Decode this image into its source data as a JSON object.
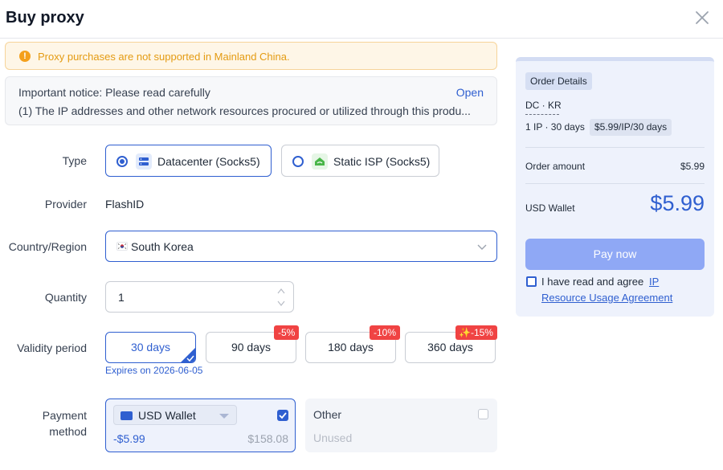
{
  "dialog": {
    "title": "Buy proxy"
  },
  "warning": {
    "text": "Proxy purchases are not supported in Mainland China.",
    "color": "#e49b12"
  },
  "notice": {
    "title": "Important notice: Please read carefully",
    "open_label": "Open",
    "body": "(1) The IP addresses and other network resources procured or utilized through this produ..."
  },
  "form": {
    "type": {
      "label": "Type",
      "options": [
        {
          "label": "Datacenter (Socks5)",
          "icon": "server-icon",
          "selected": true
        },
        {
          "label": "Static ISP (Socks5)",
          "icon": "isp-icon",
          "selected": false
        }
      ]
    },
    "provider": {
      "label": "Provider",
      "value": "FlashID"
    },
    "country": {
      "label": "Country/Region",
      "value": "South Korea",
      "icon": "south-korea-flag-icon"
    },
    "quantity": {
      "label": "Quantity",
      "value": "1"
    },
    "validity": {
      "label": "Validity period",
      "options": [
        {
          "label": "30 days",
          "discount": "",
          "selected": true
        },
        {
          "label": "90 days",
          "discount": "-5%",
          "selected": false
        },
        {
          "label": "180 days",
          "discount": "-10%",
          "selected": false
        },
        {
          "label": "360 days",
          "discount": "-15%",
          "discount_icon": "sparkle-icon",
          "selected": false
        }
      ],
      "expires": "Expires on 2026-06-05"
    },
    "payment": {
      "label_line1": "Payment",
      "label_line2": "method",
      "wallet": {
        "name": "USD Wallet",
        "amount": "-$5.99",
        "balance": "$158.08",
        "checked": true
      },
      "other": {
        "name": "Other",
        "status": "Unused",
        "checked": false
      }
    }
  },
  "order": {
    "tag": "Order Details",
    "product": "DC · KR",
    "ip_term": "1 IP · 30 days",
    "unit_price": "$5.99/IP/30 days",
    "amount_label": "Order amount",
    "amount_value": "$5.99",
    "wallet_label": "USD Wallet",
    "wallet_total": "$5.99",
    "pay_button": "Pay now",
    "agree_text": "I have read and agree",
    "agree_link_1": "IP",
    "agree_link_2": "Resource Usage Agreement"
  },
  "colors": {
    "accent": "#2f5fd0",
    "discount": "#f04343",
    "pay_button": "#8fa8f5",
    "panel_bg": "#eef2fc"
  }
}
